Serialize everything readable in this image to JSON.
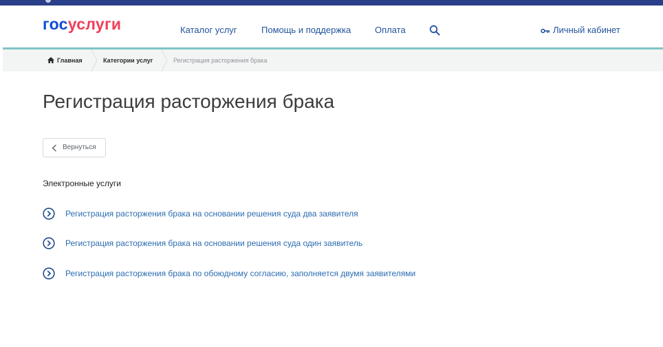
{
  "header": {
    "logo": {
      "part1": "гос",
      "part2": "услуги"
    },
    "nav": [
      {
        "label": "Каталог услуг"
      },
      {
        "label": "Помощь и поддержка"
      },
      {
        "label": "Оплата"
      }
    ],
    "search_icon": "search-icon",
    "account": {
      "label": "Личный кабинет",
      "icon": "key-icon"
    }
  },
  "breadcrumb": {
    "items": [
      {
        "label": "Главная",
        "icon": "home-icon"
      },
      {
        "label": "Категории услуг"
      },
      {
        "label": "Регистрация расторжения брака"
      }
    ]
  },
  "page": {
    "title": "Регистрация расторжения брака",
    "back_label": "Вернуться",
    "section_heading": "Электронные услуги",
    "services": [
      {
        "label": "Регистрация расторжения брака на основании решения суда два заявителя"
      },
      {
        "label": "Регистрация расторжения брака на основании решения суда один заявитель"
      },
      {
        "label": "Регистрация расторжения брака по обоюдному согласию, заполняется двумя заявителями"
      }
    ]
  },
  "colors": {
    "top_bar": "#2a3f8a",
    "logo_primary": "#0d4cd3",
    "logo_accent": "#ee3f58",
    "nav_link": "#22539d",
    "header_line": "#7fc4c6",
    "service_link": "#2b6cb0"
  }
}
